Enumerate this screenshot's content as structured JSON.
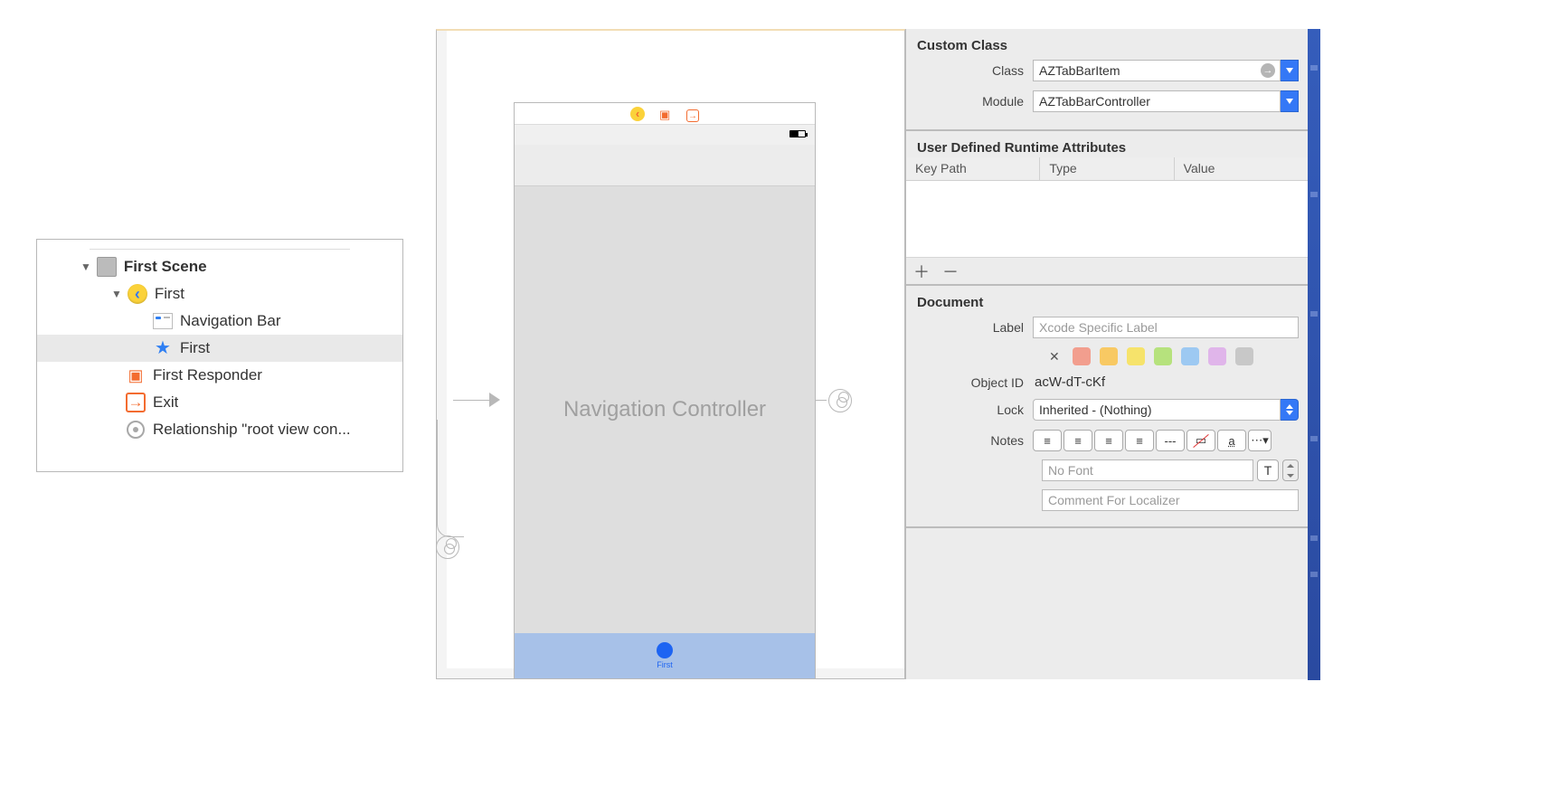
{
  "outline": {
    "scene": "First Scene",
    "controller": "First",
    "items": [
      "Navigation Bar",
      "First"
    ],
    "responder": "First Responder",
    "exit": "Exit",
    "relationship": "Relationship \"root view con..."
  },
  "canvas": {
    "scene_title": "Navigation Controller",
    "tab_label": "First"
  },
  "inspector": {
    "custom_class": {
      "title": "Custom Class",
      "class_label": "Class",
      "class_value": "AZTabBarItem",
      "module_label": "Module",
      "module_value": "AZTabBarController"
    },
    "udra": {
      "title": "User Defined Runtime Attributes",
      "cols": [
        "Key Path",
        "Type",
        "Value"
      ]
    },
    "document": {
      "title": "Document",
      "label_label": "Label",
      "label_placeholder": "Xcode Specific Label",
      "swatches": [
        "#f29e8e",
        "#f8c963",
        "#f6e36b",
        "#b6e27d",
        "#9dc9f2",
        "#e0b5ea",
        "#c8c8c8"
      ],
      "objectid_label": "Object ID",
      "objectid_value": "acW-dT-cKf",
      "lock_label": "Lock",
      "lock_value": "Inherited - (Nothing)",
      "notes_label": "Notes",
      "font_placeholder": "No Font",
      "comment_placeholder": "Comment For Localizer"
    }
  }
}
